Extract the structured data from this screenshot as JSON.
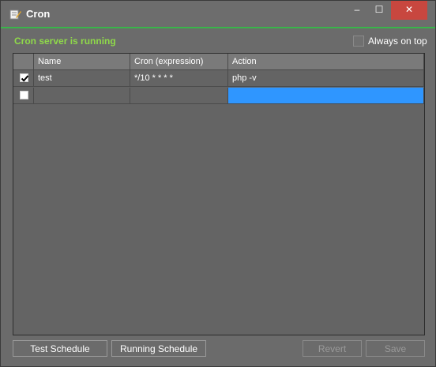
{
  "window": {
    "title": "Cron"
  },
  "titlebar": {
    "minimize_glyph": "–",
    "maximize_glyph": "☐",
    "close_glyph": "✕"
  },
  "status": {
    "text": "Cron server is running",
    "color": "#8fd94a"
  },
  "always_on_top": {
    "label": "Always on top",
    "checked": false
  },
  "grid": {
    "columns": [
      "Name",
      "Cron (expression)",
      "Action"
    ],
    "rows": [
      {
        "checked": true,
        "name": "test",
        "cron": "*/10 * * * *",
        "action": "php -v"
      },
      {
        "checked": false,
        "name": "",
        "cron": "",
        "action": ""
      }
    ]
  },
  "buttons": {
    "test_schedule": "Test Schedule",
    "running_schedule": "Running Schedule",
    "revert": "Revert",
    "save": "Save"
  },
  "colors": {
    "selection": "#2f96ff",
    "close_button": "#c8473f",
    "accent_line": "#39b54a"
  }
}
